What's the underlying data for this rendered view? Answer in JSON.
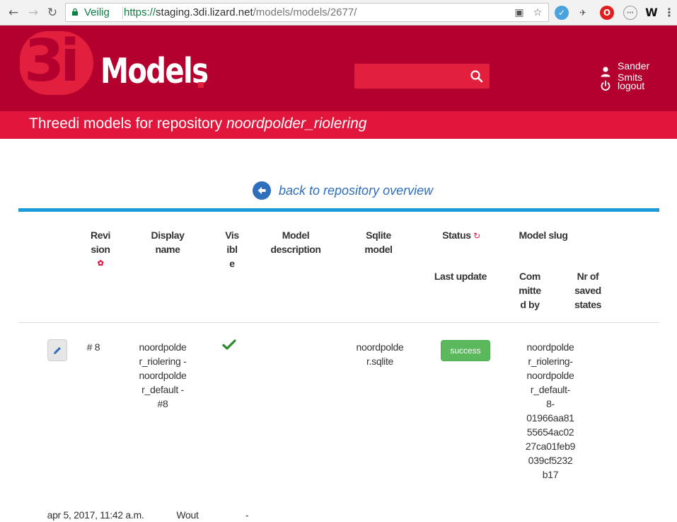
{
  "browser": {
    "secure_label": "Veilig",
    "url_proto": "https://",
    "url_host": "staging.3di.lizard.net",
    "url_path": "/models/models/2677/"
  },
  "header": {
    "logo_mark": "3i",
    "logo_text": "Models",
    "search_placeholder": "",
    "user_name": "Sander Smits",
    "logout_label": "logout"
  },
  "subheader": {
    "title_prefix": "Threedi models for repository",
    "repository": "noordpolder_riolering"
  },
  "back_link": "back to repository overview",
  "table": {
    "headers": {
      "revision": "Revi sion",
      "display_name": "Display name",
      "visible": "Vis ibl e",
      "model_description": "Model description",
      "sqlite_model": "Sqlite model",
      "status": "Status",
      "model_slug": "Model slug",
      "last_update": "Last update",
      "committed_by": "Com mitte d by",
      "nr_saved_states": "Nr of saved states"
    },
    "rows": [
      {
        "revision": "# 8",
        "display_name": "noordpolder_riolering - noordpolder_default - #8",
        "visible": true,
        "model_description": "",
        "sqlite_model": "noordpolder.sqlite",
        "status": "success",
        "model_slug": "noordpolder_riolering-noordpolder_default-8-01966aa8155654ac0227ca01feb9039cf5232b17",
        "last_update": "apr 5, 2017, 11:42 a.m.",
        "committed_by": "Wout",
        "nr_saved_states": "-"
      }
    ]
  },
  "colors": {
    "header_bg": "#b4002f",
    "subheader_bg": "#e2163c",
    "accent_blue": "#2f6fba",
    "rule_blue": "#1b9ad8",
    "success_green": "#5cb85c"
  }
}
